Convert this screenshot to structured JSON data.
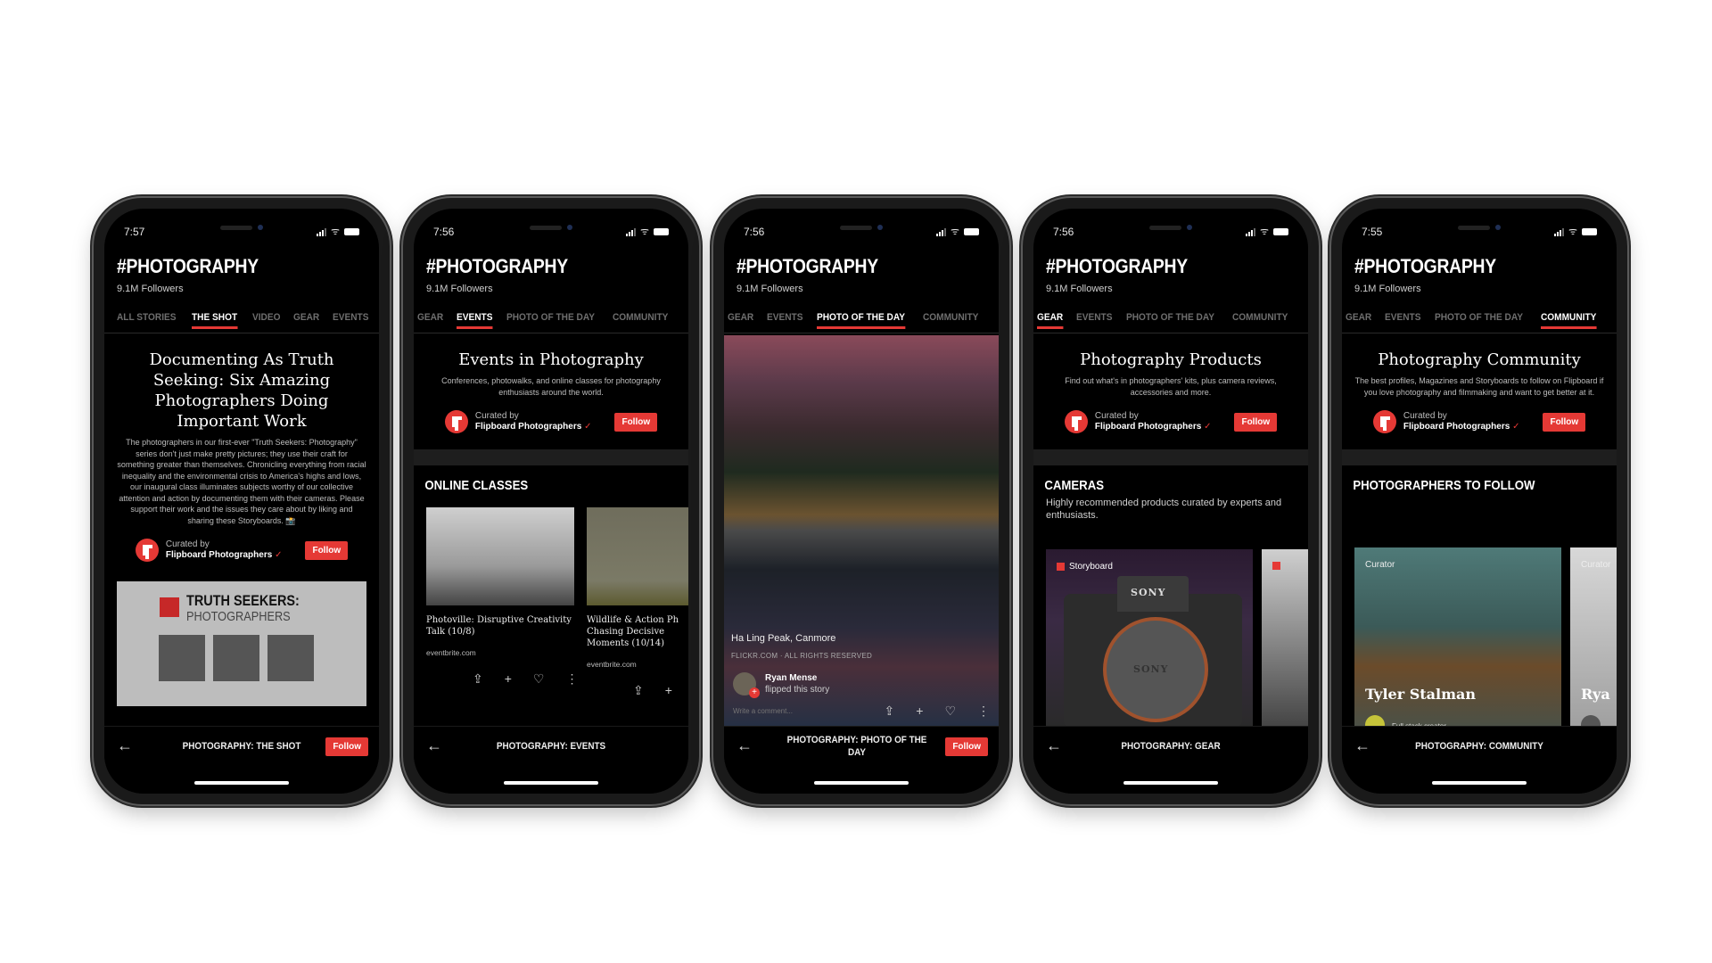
{
  "common": {
    "title": "#PHOTOGRAPHY",
    "followers": "9.1M Followers",
    "curated_by": "Curated by",
    "curator": "Flipboard Photographers",
    "check": "✓",
    "follow": "Follow",
    "back": "←",
    "wifi": "ᯤ",
    "share": "⇪",
    "add": "+",
    "like": "♡",
    "more": "⋮"
  },
  "phones": [
    {
      "time": "7:57",
      "tabs": [
        "ALL STORIES",
        "THE SHOT",
        "VIDEO",
        "GEAR",
        "EVENTS"
      ],
      "active_tab": "THE SHOT",
      "hero_title": "Documenting As Truth Seeking: Six Amazing Photographers Doing Important Work",
      "hero_desc": "The photographers in our first-ever \"Truth Seekers: Photography\" series don't just make pretty pictures; they use their craft for something greater than themselves. Chronicling everything from racial inequality and the environmental crisis to America's highs and lows, our inaugural class illuminates subjects worthy of our collective attention and action by documenting them with their cameras. Please support their work and the issues they care about by liking and sharing these Storyboards. 📸",
      "image_heading": "TRUTH SEEKERS:",
      "image_subheading": "PHOTOGRAPHERS",
      "bottom_title": "PHOTOGRAPHY: THE SHOT"
    },
    {
      "time": "7:56",
      "tabs": [
        "GEAR",
        "EVENTS",
        "PHOTO OF THE DAY",
        "COMMUNITY"
      ],
      "active_tab": "EVENTS",
      "hero_title": "Events in Photography",
      "hero_desc": "Conferences, photowalks, and online classes for photography enthusiasts around the world.",
      "section_title": "ONLINE CLASSES",
      "cards": [
        {
          "title": "Photoville: Disruptive Creativity Talk (10/8)",
          "source": "eventbrite.com"
        },
        {
          "title": "Wildlife & Action Ph Chasing Decisive Moments (10/14)",
          "source": "eventbrite.com"
        }
      ],
      "bottom_title": "PHOTOGRAPHY: EVENTS"
    },
    {
      "time": "7:56",
      "tabs": [
        "GEAR",
        "EVENTS",
        "PHOTO OF THE DAY",
        "COMMUNITY"
      ],
      "active_tab": "PHOTO OF THE DAY",
      "caption": "Ha Ling Peak, Canmore",
      "credit": "FLICKR.COM · ALL RIGHTS RESERVED",
      "flipper_name": "Ryan Mense",
      "flipper_action": "flipped this story",
      "comment_placeholder": "Write a comment...",
      "bottom_title": "PHOTOGRAPHY: PHOTO OF THE DAY"
    },
    {
      "time": "7:56",
      "tabs": [
        "GEAR",
        "EVENTS",
        "PHOTO OF THE DAY",
        "COMMUNITY"
      ],
      "active_tab": "GEAR",
      "hero_title": "Photography Products",
      "hero_desc": "Find out what's in photographers' kits, plus camera reviews, accessories and more.",
      "section_title": "CAMERAS",
      "section_desc": "Highly recommended products curated by experts and enthusiasts.",
      "card_label": "Storyboard",
      "camera_brand": "SONY",
      "bottom_title": "PHOTOGRAPHY: GEAR"
    },
    {
      "time": "7:55",
      "tabs": [
        "GEAR",
        "EVENTS",
        "PHOTO OF THE DAY",
        "COMMUNITY"
      ],
      "active_tab": "COMMUNITY",
      "hero_title": "Photography Community",
      "hero_desc": "The best profiles, Magazines and Storyboards to follow on Flipboard if you love photography and filmmaking and want to get better at it.",
      "section_title": "PHOTOGRAPHERS TO FOLLOW",
      "card_tag": "Curator",
      "person_name": "Tyler Stalman",
      "person_role": "Full stack creator",
      "next_person_partial": "Rya",
      "bottom_title": "PHOTOGRAPHY: COMMUNITY"
    }
  ]
}
